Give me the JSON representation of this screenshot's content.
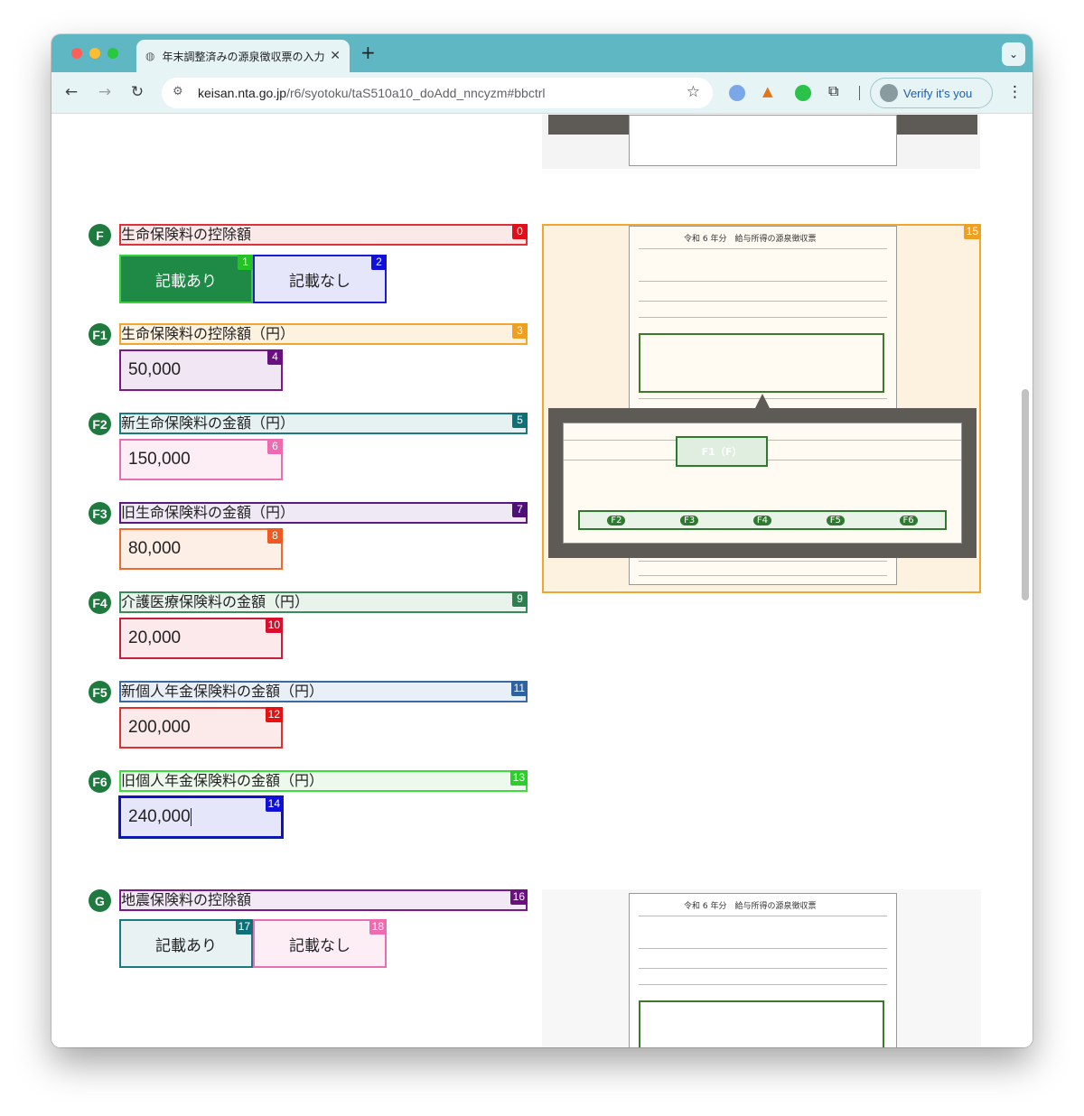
{
  "browser": {
    "tab_title": "年末調整済みの源泉徴収票の入力",
    "url_host": "keisan.nta.go.jp",
    "url_path": "/r6/syotoku/taS510a10_doAdd_nncyzm#bbctrl",
    "profile_label": "Verify it's you"
  },
  "sections": [
    {
      "marker": "F",
      "label": "生命保険料の控除額",
      "label_badge": "0",
      "type": "choice",
      "options": [
        {
          "label": "記載あり",
          "badge": "1"
        },
        {
          "label": "記載なし",
          "badge": "2"
        }
      ],
      "selected": "記載あり"
    },
    {
      "marker": "F1",
      "label": "生命保険料の控除額（円）",
      "label_badge": "3",
      "type": "input",
      "value": "50,000",
      "input_badge": "4"
    },
    {
      "marker": "F2",
      "label": "新生命保険料の金額（円）",
      "label_badge": "5",
      "type": "input",
      "value": "150,000",
      "input_badge": "6"
    },
    {
      "marker": "F3",
      "label": "旧生命保険料の金額（円）",
      "label_badge": "7",
      "type": "input",
      "value": "80,000",
      "input_badge": "8"
    },
    {
      "marker": "F4",
      "label": "介護医療保険料の金額（円）",
      "label_badge": "9",
      "type": "input",
      "value": "20,000",
      "input_badge": "10"
    },
    {
      "marker": "F5",
      "label": "新個人年金保険料の金額（円）",
      "label_badge": "11",
      "type": "input",
      "value": "200,000",
      "input_badge": "12"
    },
    {
      "marker": "F6",
      "label": "旧個人年金保険料の金額（円）",
      "label_badge": "13",
      "type": "input",
      "value": "240,000",
      "input_badge": "14"
    },
    {
      "marker": "G",
      "label": "地震保険料の控除額",
      "label_badge": "16",
      "type": "choice",
      "options": [
        {
          "label": "記載あり",
          "badge": "17"
        },
        {
          "label": "記載なし",
          "badge": "18"
        }
      ]
    }
  ],
  "reference_image": {
    "badge": "15",
    "form_title": "令和 6 年分　給与所得の源泉徴収票",
    "callout_main": "F1（F）",
    "callout_markers": [
      "F2",
      "F3",
      "F4",
      "F5",
      "F6"
    ]
  },
  "colors": {
    "selected_button": "#1e8a45",
    "marker_green": "#1e7a3e"
  }
}
